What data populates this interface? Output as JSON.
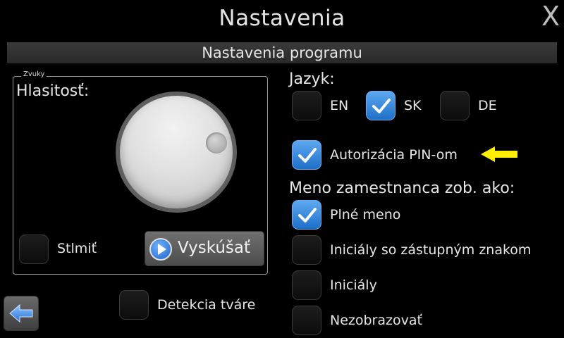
{
  "header": {
    "title": "Nastavenia",
    "close_label": "X"
  },
  "section": {
    "title": "Nastavenia programu"
  },
  "sound": {
    "group_label": "Zvuky",
    "volume_label": "Hlasitosť:",
    "mute_label": "Stlmiť",
    "mute_checked": false,
    "try_label": "Vyskúšať"
  },
  "face_detection": {
    "label": "Detekcia tváre",
    "checked": false
  },
  "language": {
    "heading": "Jazyk:",
    "options": [
      {
        "label": "EN",
        "checked": false
      },
      {
        "label": "SK",
        "checked": true
      },
      {
        "label": "DE",
        "checked": false
      }
    ]
  },
  "pin_auth": {
    "label": "Autorizácia PIN-om",
    "checked": true
  },
  "employee_name": {
    "heading": "Meno zamestnanca zob. ako:",
    "options": [
      {
        "label": "Plné meno",
        "checked": true
      },
      {
        "label": "Iniciály so zástupným znakom",
        "checked": false
      },
      {
        "label": "Iniciály",
        "checked": false
      },
      {
        "label": "Nezobrazovať",
        "checked": false
      }
    ]
  },
  "colors": {
    "accent": "#2f86e0",
    "arrow": "#ffee00"
  },
  "icons": {
    "close": "close-icon",
    "back": "back-arrow-icon",
    "play": "play-icon",
    "pointer": "yellow-arrow-icon"
  }
}
